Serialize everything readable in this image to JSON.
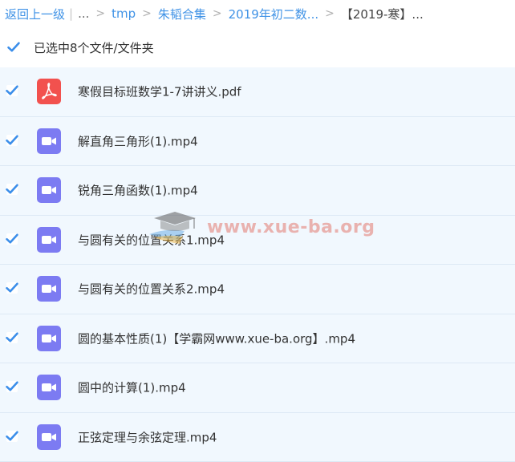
{
  "breadcrumb": {
    "back": "返回上一级",
    "bar": "|",
    "ellipsis": "...",
    "sep": ">",
    "items": [
      "tmp",
      "朱韬合集",
      "2019年初二数..."
    ],
    "current": "【2019-寒】..."
  },
  "selection": {
    "label": "已选中8个文件/文件夹",
    "checked": true
  },
  "files": [
    {
      "name": "寒假目标班数学1-7讲讲义.pdf",
      "type": "pdf",
      "checked": true
    },
    {
      "name": "解直角三角形(1).mp4",
      "type": "video",
      "checked": true
    },
    {
      "name": "锐角三角函数(1).mp4",
      "type": "video",
      "checked": true
    },
    {
      "name": "与圆有关的位置关系1.mp4",
      "type": "video",
      "checked": true
    },
    {
      "name": "与圆有关的位置关系2.mp4",
      "type": "video",
      "checked": true
    },
    {
      "name": "圆的基本性质(1)【学霸网www.xue-ba.org】.mp4",
      "type": "video",
      "checked": true
    },
    {
      "name": "圆中的计算(1).mp4",
      "type": "video",
      "checked": true
    },
    {
      "name": "正弦定理与余弦定理.mp4",
      "type": "video",
      "checked": true
    }
  ],
  "watermark": {
    "text": "www.xue-ba.org"
  },
  "colors": {
    "link": "#3f92e6",
    "check": "#3b8eea",
    "pdf": "#f2514e",
    "video": "#7c7bf2",
    "row_bg": "#f1f8fe"
  },
  "icons": {
    "checkbox": "checkbox-checked-icon",
    "pdf": "pdf-file-icon",
    "video": "video-file-icon",
    "watermark": "graduation-cap-logo"
  }
}
